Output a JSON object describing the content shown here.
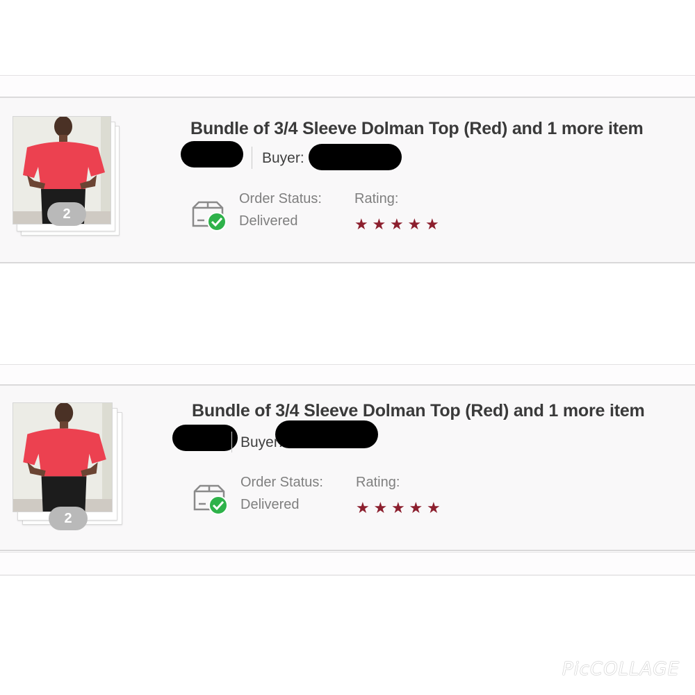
{
  "orders": [
    {
      "title": "Bundle of 3/4 Sleeve Dolman Top (Red) and 1 more item",
      "buyer_label": "Buyer:",
      "item_count": "2",
      "order_status_label": "Order Status:",
      "order_status_value": "Delivered",
      "rating_label": "Rating:",
      "rating_value": 5,
      "thumbnail_icon": "product-photo-red-top"
    },
    {
      "title": "Bundle of 3/4 Sleeve Dolman Top (Red) and 1 more item",
      "buyer_label": "Buyer:",
      "item_count": "2",
      "order_status_label": "Order Status:",
      "order_status_value": "Delivered",
      "rating_label": "Rating:",
      "rating_value": 5,
      "thumbnail_icon": "product-photo-red-top"
    }
  ],
  "icons": {
    "status": "box-delivered-check-icon",
    "rating": "star-icon"
  },
  "colors": {
    "star": "#8c1f2e",
    "check": "#2eb24a",
    "badge": "#b9b9b9"
  },
  "watermark": "PicCOLLAGE"
}
